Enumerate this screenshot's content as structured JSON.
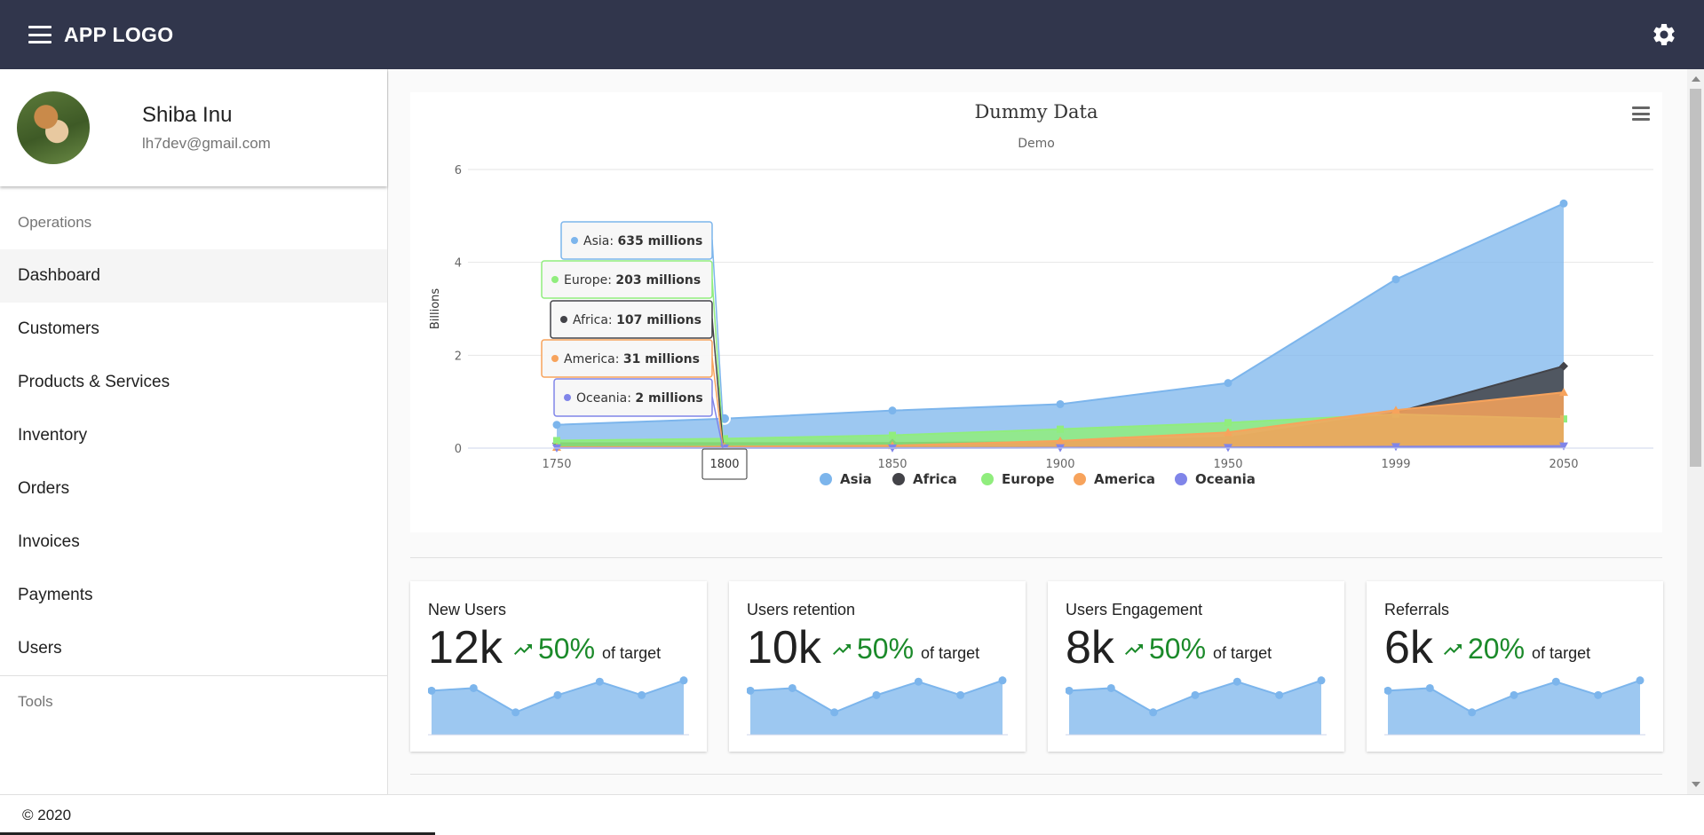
{
  "app": {
    "logo": "APP LOGO"
  },
  "profile": {
    "name": "Shiba Inu",
    "email": "lh7dev@gmail.com"
  },
  "sidebar": {
    "section_operations": "Operations",
    "items": [
      {
        "label": "Dashboard",
        "active": true
      },
      {
        "label": "Customers"
      },
      {
        "label": "Products & Services"
      },
      {
        "label": "Inventory"
      },
      {
        "label": "Orders"
      },
      {
        "label": "Invoices"
      },
      {
        "label": "Payments"
      },
      {
        "label": "Users"
      }
    ],
    "section_tools": "Tools"
  },
  "chart_data": {
    "type": "area",
    "title": "Dummy Data",
    "subtitle": "Demo",
    "ylabel": "Billions",
    "ylim": [
      0,
      6
    ],
    "yticks": [
      0,
      2,
      4,
      6
    ],
    "categories": [
      "1750",
      "1800",
      "1850",
      "1900",
      "1950",
      "1999",
      "2050"
    ],
    "series": [
      {
        "name": "Asia",
        "color": "#7cb5ec",
        "values": [
          0.502,
          0.635,
          0.809,
          0.947,
          1.402,
          3.634,
          5.268
        ]
      },
      {
        "name": "Africa",
        "color": "#434348",
        "values": [
          0.106,
          0.107,
          0.111,
          0.133,
          0.221,
          0.767,
          1.766
        ]
      },
      {
        "name": "Europe",
        "color": "#90ed7d",
        "values": [
          0.163,
          0.203,
          0.276,
          0.408,
          0.547,
          0.729,
          0.628
        ]
      },
      {
        "name": "America",
        "color": "#f7a35c",
        "values": [
          0.018,
          0.031,
          0.054,
          0.156,
          0.339,
          0.818,
          1.201
        ]
      },
      {
        "name": "Oceania",
        "color": "#8085e9",
        "values": [
          0.002,
          0.002,
          0.002,
          0.006,
          0.013,
          0.03,
          0.046
        ]
      }
    ],
    "legend": "bottom",
    "tooltip": {
      "category": "1800",
      "rows": [
        {
          "series": "Asia",
          "text": "Asia: ",
          "value": "635 millions"
        },
        {
          "series": "Europe",
          "text": "Europe: ",
          "value": "203 millions"
        },
        {
          "series": "Africa",
          "text": "Africa: ",
          "value": "107 millions"
        },
        {
          "series": "America",
          "text": "America: ",
          "value": "31 millions"
        },
        {
          "series": "Oceania",
          "text": "Oceania: ",
          "value": "2 millions"
        }
      ]
    }
  },
  "stats": [
    {
      "label": "New Users",
      "value": "12k",
      "pct": "50%",
      "of": "of target"
    },
    {
      "label": "Users retention",
      "value": "10k",
      "pct": "50%",
      "of": "of target"
    },
    {
      "label": "Users Engagement",
      "value": "8k",
      "pct": "50%",
      "of": "of target"
    },
    {
      "label": "Referrals",
      "value": "6k",
      "pct": "20%",
      "of": "of target"
    }
  ],
  "sparkline": [
    0.69,
    0.73,
    0.35,
    0.62,
    0.83,
    0.62,
    0.85
  ],
  "footer": {
    "copyright": "© 2020"
  },
  "icons": {
    "menu": "hamburger-icon",
    "settings": "gear-icon",
    "chart_menu": "chart-menu-icon",
    "trend": "trending-up-icon"
  }
}
